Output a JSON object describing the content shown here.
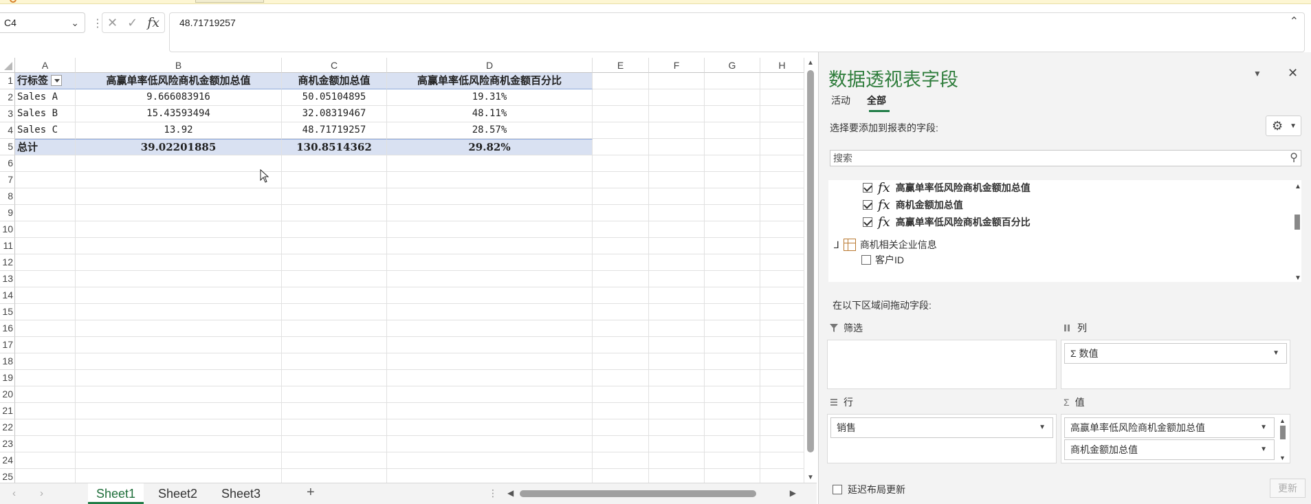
{
  "formula_bar": {
    "name_box": "C4",
    "cancel_glyph": "✕",
    "enter_glyph": "✓",
    "fx_label": "fx",
    "formula": "48.71719257",
    "sep": "⋮"
  },
  "grid": {
    "columns": [
      "A",
      "B",
      "C",
      "D",
      "E",
      "F",
      "G",
      "H"
    ],
    "rows": [
      "1",
      "2",
      "3",
      "4",
      "5",
      "6",
      "7",
      "8",
      "9",
      "10",
      "11",
      "12",
      "13",
      "14",
      "15",
      "16",
      "17",
      "18",
      "19",
      "20",
      "21",
      "22",
      "23",
      "24",
      "25"
    ],
    "header": [
      "行标签",
      "高赢单率低风险商机金额加总值",
      "商机金额加总值",
      "高赢单率低风险商机金额百分比"
    ],
    "data": [
      [
        "Sales A",
        "9.666083916",
        "50.05104895",
        "19.31%"
      ],
      [
        "Sales B",
        "15.43593494",
        "32.08319467",
        "48.11%"
      ],
      [
        "Sales C",
        "13.92",
        "48.71719257",
        "28.57%"
      ]
    ],
    "total": [
      "总计",
      "39.02201885",
      "130.8514362",
      "29.82%"
    ]
  },
  "sheets": {
    "tabs": [
      "Sheet1",
      "Sheet2",
      "Sheet3"
    ],
    "active": "Sheet1",
    "add": "+"
  },
  "pivot_pane": {
    "title": "数据透视表字段",
    "tabs": [
      "活动",
      "全部"
    ],
    "active_tab": "全部",
    "choose_label": "选择要添加到报表的字段:",
    "search_placeholder": "搜索",
    "fields": [
      {
        "fx": "fx",
        "label": "高赢单率低风险商机金额加总值",
        "checked": true
      },
      {
        "fx": "fx",
        "label": "商机金额加总值",
        "checked": true
      },
      {
        "fx": "fx",
        "label": "高赢单率低风险商机金额百分比",
        "checked": true
      }
    ],
    "table_name": "商机相关企业信息",
    "table_expander": "⅃",
    "sub_field": "客户ID",
    "drag_label": "在以下区域间拖动字段:",
    "areas": {
      "filter": {
        "label": "筛选"
      },
      "columns": {
        "label": "列",
        "items": [
          "Σ 数值"
        ]
      },
      "rows": {
        "label": "行",
        "items": [
          "销售"
        ]
      },
      "values": {
        "label": "值",
        "items": [
          "高赢单率低风险商机金额加总值",
          "商机金额加总值"
        ]
      }
    },
    "defer_label": "延迟布局更新",
    "update_label": "更新"
  },
  "colors": {
    "accent": "#2f7d3c",
    "pivot_header_bg": "#d9e1f2",
    "sheet_active": "#1e7b45"
  },
  "icons": [
    "chevron-down-icon",
    "cancel-icon",
    "enter-icon",
    "fx-icon",
    "collapse-icon",
    "gear-icon",
    "search-icon",
    "close-icon",
    "filter-icon",
    "columns-icon",
    "rows-icon",
    "sigma-icon",
    "table-icon",
    "checkbox-icon"
  ]
}
